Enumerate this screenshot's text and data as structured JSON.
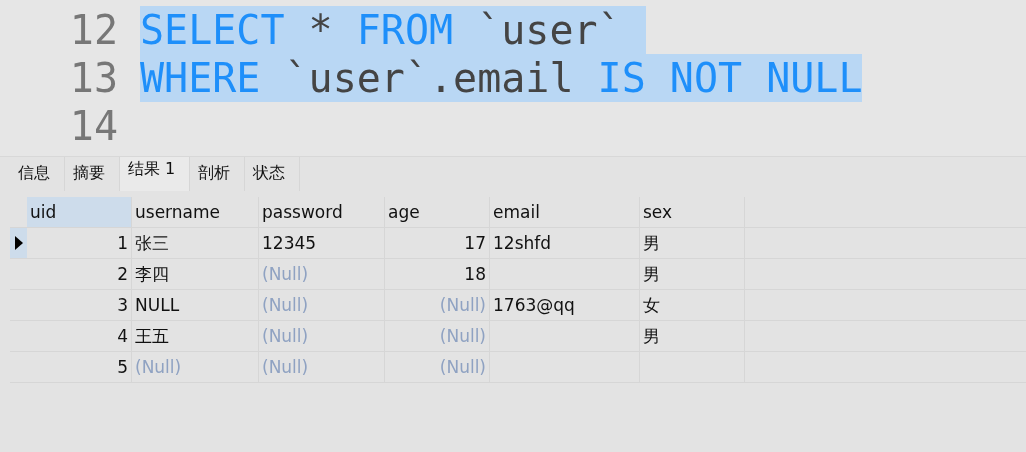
{
  "editor": {
    "lines": [
      {
        "number": "12",
        "selected": true,
        "tokens": [
          {
            "text": "SELECT",
            "kind": "keyword"
          },
          {
            "text": " * ",
            "kind": "plain"
          },
          {
            "text": "FROM",
            "kind": "keyword"
          },
          {
            "text": " `user` ",
            "kind": "plain"
          }
        ]
      },
      {
        "number": "13",
        "selected": true,
        "tokens": [
          {
            "text": "WHERE",
            "kind": "keyword"
          },
          {
            "text": " `user`.email ",
            "kind": "plain"
          },
          {
            "text": "IS NOT NULL",
            "kind": "keyword"
          }
        ]
      },
      {
        "number": "14"
      }
    ]
  },
  "tabs": [
    {
      "label": "信息",
      "selected": false
    },
    {
      "label": "摘要",
      "selected": false
    },
    {
      "label": "结果 1",
      "selected": true
    },
    {
      "label": "剖析",
      "selected": false
    },
    {
      "label": "状态",
      "selected": false
    }
  ],
  "table": {
    "columns": [
      {
        "label": "uid",
        "kind": "numeric",
        "selected": true
      },
      {
        "label": "username",
        "kind": "text",
        "selected": false
      },
      {
        "label": "password",
        "kind": "text",
        "selected": false
      },
      {
        "label": "age",
        "kind": "numeric",
        "selected": false
      },
      {
        "label": "email",
        "kind": "text",
        "selected": false
      },
      {
        "label": "sex",
        "kind": "text",
        "selected": false
      }
    ],
    "rows": [
      {
        "selected": true,
        "cells": [
          {
            "text": "1",
            "kind": "value"
          },
          {
            "text": "张三",
            "kind": "value"
          },
          {
            "text": "12345",
            "kind": "value"
          },
          {
            "text": "17",
            "kind": "value"
          },
          {
            "text": "12shfd",
            "kind": "value"
          },
          {
            "text": "男",
            "kind": "value"
          }
        ]
      },
      {
        "selected": false,
        "cells": [
          {
            "text": "2",
            "kind": "value"
          },
          {
            "text": "李四",
            "kind": "value"
          },
          {
            "text": "(Null)",
            "kind": "null"
          },
          {
            "text": "18",
            "kind": "value"
          },
          null,
          {
            "text": "男",
            "kind": "value"
          }
        ]
      },
      {
        "selected": false,
        "cells": [
          {
            "text": "3",
            "kind": "value"
          },
          {
            "text": "NULL",
            "kind": "value"
          },
          {
            "text": "(Null)",
            "kind": "null"
          },
          {
            "text": "(Null)",
            "kind": "null"
          },
          {
            "text": "1763@qq",
            "kind": "value"
          },
          {
            "text": "女",
            "kind": "value"
          }
        ]
      },
      {
        "selected": false,
        "cells": [
          {
            "text": "4",
            "kind": "value"
          },
          {
            "text": "王五",
            "kind": "value"
          },
          {
            "text": "(Null)",
            "kind": "null"
          },
          {
            "text": "(Null)",
            "kind": "null"
          },
          null,
          {
            "text": "男",
            "kind": "value"
          }
        ]
      },
      {
        "selected": false,
        "cells": [
          {
            "text": "5",
            "kind": "value"
          },
          {
            "text": "(Null)",
            "kind": "null"
          },
          {
            "text": "(Null)",
            "kind": "null"
          },
          {
            "text": "(Null)",
            "kind": "null"
          },
          null,
          null
        ]
      }
    ]
  }
}
